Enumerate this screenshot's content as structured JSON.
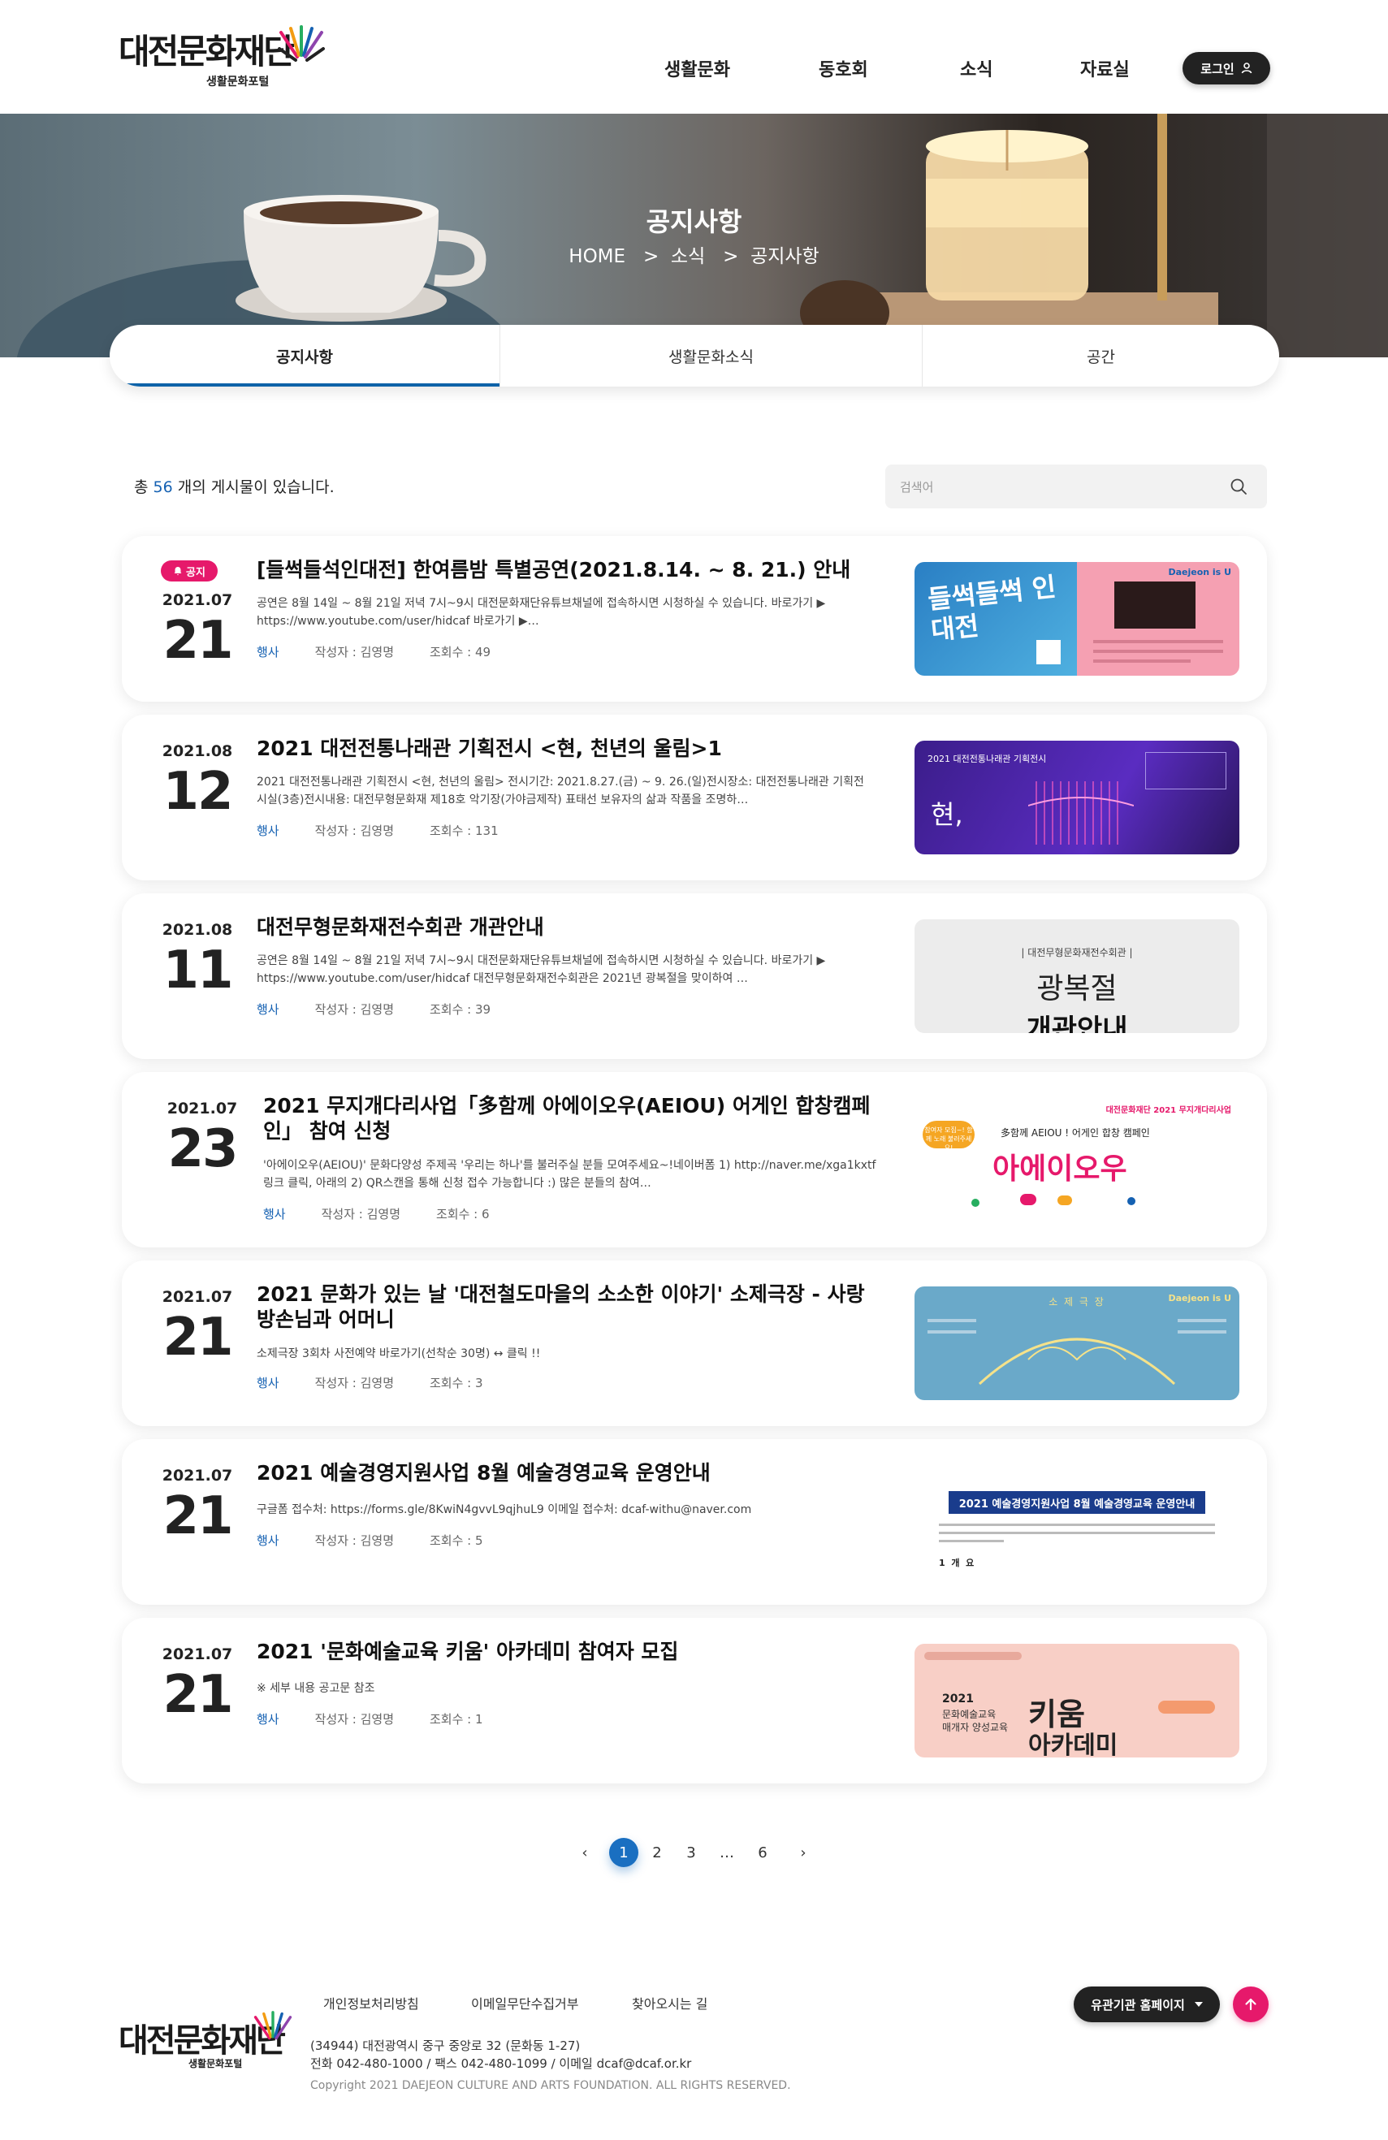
{
  "header": {
    "logo_title": "대전문화재단",
    "logo_subtitle": "생활문화포털",
    "nav": [
      "생활문화",
      "동호회",
      "소식",
      "자료실"
    ],
    "login_label": "로그인"
  },
  "hero": {
    "title": "공지사항",
    "breadcrumb": [
      "HOME",
      "소식",
      "공지사항"
    ]
  },
  "tabs": [
    "공지사항",
    "생활문화소식",
    "공간"
  ],
  "list": {
    "count_prefix": "총",
    "count": "56",
    "count_suffix": "개의 게시물이 있습니다.",
    "search_placeholder": "검색어"
  },
  "posts": [
    {
      "badge": "공지",
      "ym": "2021.07",
      "day": "21",
      "title": "[들썩들석인대전] 한여름밤 특별공연(2021.8.14. ~ 8. 21.) 안내",
      "desc": "공연은 8월 14일 ~ 8월 21일 저녁 7시~9시 대전문화재단유튜브채널에 접속하시면 시청하실 수 있습니다. 바로가기 ▶ https://www.youtube.com/user/hidcaf 바로가기 ▶…",
      "category": "행사",
      "writer": "작성자 : 김영명",
      "views": "조회수 : 49",
      "thumb_title": "들썩들썩 인 대전",
      "thumb_brand": "Daejeon is U"
    },
    {
      "ym": "2021.08",
      "day": "12",
      "title": "2021 대전전통나래관 기획전시 <현, 천년의 울림>1",
      "desc": "2021 대전전통나래관 기획전시 <현, 천년의 울림> 전시기간: 2021.8.27.(금) ~ 9. 26.(일)전시장소: 대전전통나래관 기획전시실(3층)전시내용: 대전무형문화재 제18호 악기장(가야금제작) 표태선 보유자의 삶과 작품을 조명하…",
      "category": "행사",
      "writer": "작성자 : 김영명",
      "views": "조회수 : 131",
      "thumb_title": "현,",
      "thumb_caption": "2021 대전전통나래관 기획전시"
    },
    {
      "ym": "2021.08",
      "day": "11",
      "title": "대전무형문화재전수회관 개관안내",
      "desc": "공연은 8월 14일 ~ 8월 21일 저녁 7시~9시 대전문화재단유튜브채널에 접속하시면 시청하실 수 있습니다. 바로가기 ▶ https://www.youtube.com/user/hidcaf 대전무형문화재전수회관은 2021년 광복절을 맞이하여 …",
      "category": "행사",
      "writer": "작성자 : 김영명",
      "views": "조회수 : 39",
      "thumb_caption": "| 대전무형문화재전수회관 |",
      "thumb_title": "광복절",
      "thumb_title2": "개관안내"
    },
    {
      "ym": "2021.07",
      "day": "23",
      "title": "2021 무지개다리사업「多함께 아에이오우(AEIOU) 어게인 합창캠페인」 참여 신청",
      "desc": "'아에이오우(AEIOU)' 문화다양성 주제곡 '우리는 하나'를 불러주실 분들 모여주세요~!네이버폼 1) http://naver.me/xga1kxtf 링크 클릭, 아래의 2) QR스캔을 통해 신청 접수 가능합니다 :) 많은 분들의 참여…",
      "category": "행사",
      "writer": "작성자 : 김영명",
      "views": "조회수 : 6",
      "thumb_title": "아에이오우",
      "thumb_caption": "多함께 AEIOU ! 어게인 합창 캠페인",
      "thumb_bubble": "참여자 모집~! 함께 노래 불러주세요!",
      "thumb_top": "대전문화재단 2021 무지개다리사업"
    },
    {
      "ym": "2021.07",
      "day": "21",
      "title": "2021 문화가 있는 날 '대전철도마을의 소소한 이야기' 소제극장 - 사랑방손님과 어머니",
      "desc": "소제극장 3회차 사전예약 바로가기(선착순 30명) ↔ 클릭 !!",
      "category": "행사",
      "writer": "작성자 : 김영명",
      "views": "조회수 : 3",
      "thumb_title": "소 제 극 장",
      "thumb_brand": "Daejeon is U"
    },
    {
      "ym": "2021.07",
      "day": "21",
      "title": "2021 예술경영지원사업 8월 예술경영교육 운영안내",
      "desc": "구글폼 접수처: https://forms.gle/8KwiN4gvvL9qjhuL9 이메일 접수처: dcaf-withu@naver.com",
      "category": "행사",
      "writer": "작성자 : 김영명",
      "views": "조회수 : 5",
      "thumb_title": "2021 예술경영지원사업 8월 예술경영교육 운영안내",
      "thumb_footer": "1  개  요"
    },
    {
      "ym": "2021.07",
      "day": "21",
      "title": "2021 '문화예술교육 키움' 아카데미 참여자 모집",
      "desc": "※ 세부 내용 공고문 참조",
      "category": "행사",
      "writer": "작성자 : 김영명",
      "views": "조회수 : 1",
      "thumb_title": "키움",
      "thumb_title2": "아카데미",
      "thumb_caption": "2021",
      "thumb_caption2": "문화예술교육",
      "thumb_caption3": "매개자 양성교육"
    }
  ],
  "pagination": {
    "prev": "‹",
    "pages": [
      "1",
      "2",
      "3",
      "…",
      "6"
    ],
    "current": "1",
    "next": "›"
  },
  "footer": {
    "links": [
      "개인정보처리방침",
      "이메일무단수집거부",
      "찾아오시는 길"
    ],
    "address": "(34944) 대전광역시 중구 중앙로 32 (문화동 1-27)",
    "contact": "전화 042-480-1000 / 팩스 042-480-1099 / 이메일 dcaf@dcaf.or.kr",
    "copyright": "Copyright 2021 DAEJEON CULTURE AND ARTS FOUNDATION. ALL RIGHTS RESERVED.",
    "related_label": "유관기관 홈페이지"
  },
  "colors": {
    "accent": "#1561b2",
    "badge": "#e6196b",
    "dark_button": "#222222"
  }
}
